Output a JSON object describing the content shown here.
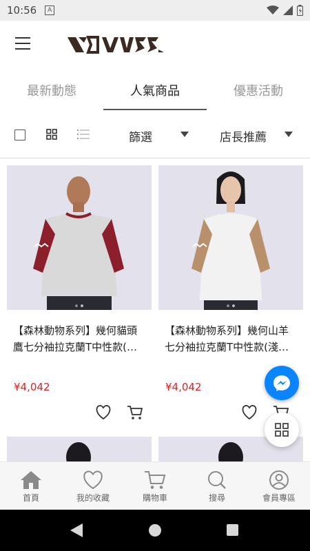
{
  "status_bar": {
    "time": "10:56",
    "notif_letter": "A"
  },
  "header": {
    "logo_alt": "logo"
  },
  "tabs": [
    {
      "label": "最新動態",
      "active": false
    },
    {
      "label": "人氣商品",
      "active": true
    },
    {
      "label": "優惠活動",
      "active": false
    }
  ],
  "toolbar": {
    "filter_label": "篩選",
    "sort_label": "店長推薦"
  },
  "products": [
    {
      "title": "【森林動物系列】幾何貓頭鷹七分袖拉克蘭T中性款(…",
      "price": "¥4,042",
      "sleeve_color": "#8c1f2c"
    },
    {
      "title": "【森林動物系列】幾何山羊七分袖拉克蘭T中性款(淺…",
      "price": "¥4,042",
      "sleeve_color": "#b8916c"
    }
  ],
  "bottom_nav": [
    {
      "label": "首頁",
      "icon": "home-icon"
    },
    {
      "label": "我的收藏",
      "icon": "heart-icon"
    },
    {
      "label": "購物車",
      "icon": "cart-icon"
    },
    {
      "label": "搜尋",
      "icon": "search-icon"
    },
    {
      "label": "會員專區",
      "icon": "user-icon"
    }
  ],
  "colors": {
    "accent": "#0a84ff",
    "price": "#e02020",
    "nav_icon": "#8a8a8a"
  }
}
